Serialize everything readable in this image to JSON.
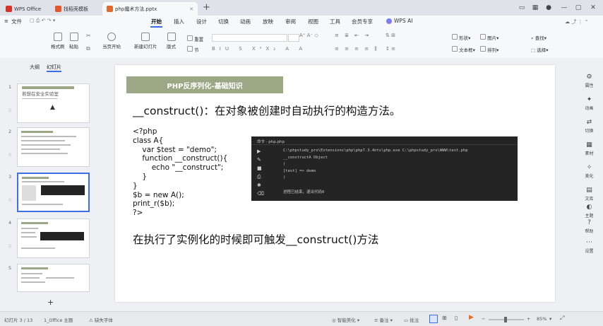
{
  "titlebar": {
    "tabs": [
      {
        "label": "WPS Office",
        "color": "#d9312a"
      },
      {
        "label": "找稻壳模板",
        "color": "#e4572e"
      },
      {
        "label": "php魔术方法.pptx",
        "color": "#e06a2c"
      }
    ],
    "add_tab": "+"
  },
  "menubar": {
    "file": "文件",
    "items": [
      "开始",
      "插入",
      "设计",
      "切换",
      "动画",
      "放映",
      "审阅",
      "视图",
      "工具",
      "会员专享"
    ],
    "ai": "WPS AI"
  },
  "ribbon": {
    "buttons": [
      "格式刷",
      "粘贴",
      "当页开始",
      "新建幻灯片",
      "版式",
      "节",
      "重置"
    ],
    "right_buttons": [
      "形状",
      "图片",
      "查找",
      "文本框",
      "排列",
      "选择"
    ]
  },
  "leftpanel": {
    "tabs": [
      "大纲",
      "幻灯片"
    ],
    "slide_numbers": [
      "1",
      "2",
      "3",
      "4",
      "5"
    ],
    "slide1_title": "若想在安全实验室",
    "add": "+"
  },
  "slide": {
    "header": "PHP反序列化-基础知识",
    "title": "__construct()：在对象被创建时自动执行的构造方法。",
    "code_lines": [
      "<?php",
      "class A{",
      "    var $test = \"demo\";",
      "    function __construct(){",
      "        echo \"__construct\";",
      "    }",
      "}",
      "$b = new A();",
      "print_r($b);",
      "?>"
    ],
    "terminal": {
      "tab": "命令 · php.php",
      "lines": [
        "C:\\phpstudy_pro\\Extensions\\php\\php7.3.4nts\\php.exe C:\\phpstudy_pro\\WWW\\test.php",
        "__constructA Object",
        "(",
        "    [test] => demo",
        ")",
        "进程已结束，退出代码0"
      ]
    },
    "bottom_text": "在执行了实例化的时候即可触发__construct()方法"
  },
  "rightbar": {
    "items": [
      "属性",
      "动画",
      "切换",
      "素材",
      "美化",
      "文库",
      "主题",
      "帮助",
      "设置"
    ]
  },
  "statusbar": {
    "slide_counter": "幻灯片 3 / 13",
    "theme": "1_Office 主题",
    "font_missing": "缺失字体",
    "beautify": "智能美化",
    "notes": "备注",
    "comments": "批注",
    "zoom": "85%"
  },
  "colors": {
    "accent": "#3a6ee8",
    "header_bar": "#9ca785",
    "terminal_bg": "#242424"
  }
}
